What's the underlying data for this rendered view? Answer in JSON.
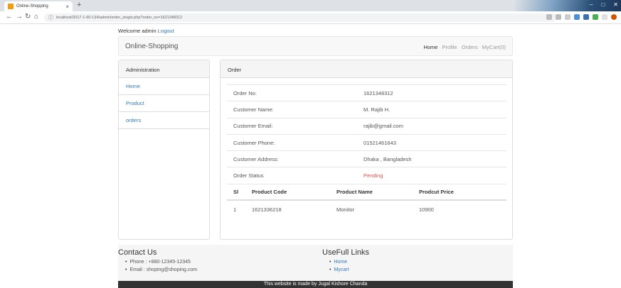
{
  "browser": {
    "tab_title": "Online-Shopping",
    "tab_close": "×",
    "new_tab": "+",
    "url": "localhost/2017-1-60-134/admin/order_single.php?order_no=1621348312",
    "colors": {
      "favicon": "#f39c12"
    },
    "icons": [
      "back-icon",
      "forward-icon",
      "reload-icon",
      "home-icon",
      "info-icon",
      "close-icon",
      "new-tab-icon",
      "minimize-icon",
      "maximize-icon"
    ]
  },
  "header": {
    "welcome_text": "Welcome admin",
    "logout_label": "Logout",
    "brand": "Online-Shopping",
    "nav": {
      "home": "Home",
      "profile": "Profile",
      "orders": "Orders",
      "cart": "MyCart(0)"
    }
  },
  "sidebar": {
    "title": "Administration",
    "items": [
      {
        "label": "Home"
      },
      {
        "label": "Product"
      },
      {
        "label": "orders"
      }
    ]
  },
  "order": {
    "title": "Order",
    "fields": [
      {
        "label": "Order No:",
        "value": "1621348312"
      },
      {
        "label": "Customer Name:",
        "value": "M. Rajib H."
      },
      {
        "label": "Customer Email:",
        "value": "rajib@gmail.com"
      },
      {
        "label": "Customer Phone:",
        "value": "01521461643"
      },
      {
        "label": "Customer Address:",
        "value": "Dhaka , Bangladesh"
      },
      {
        "label": "Order Status",
        "value": "Pending"
      }
    ],
    "products": {
      "headers": [
        "Sl",
        "Product Code",
        "Product Name",
        "Prodcut Price"
      ],
      "rows": [
        [
          "1",
          "1621336218",
          "Monitor",
          "10900"
        ]
      ]
    },
    "colors": {
      "status_pending": "#d9534f",
      "link": "#337ab7"
    }
  },
  "footer": {
    "contact_title": "Contact Us",
    "contact": [
      "Phone : +880-12345-12345",
      "Email : shoping@shoping.com"
    ],
    "links_title": "UseFull Links",
    "links": [
      "Home",
      "Mycart"
    ],
    "credit": "This website is made by Jugal Kishore Chanda"
  }
}
